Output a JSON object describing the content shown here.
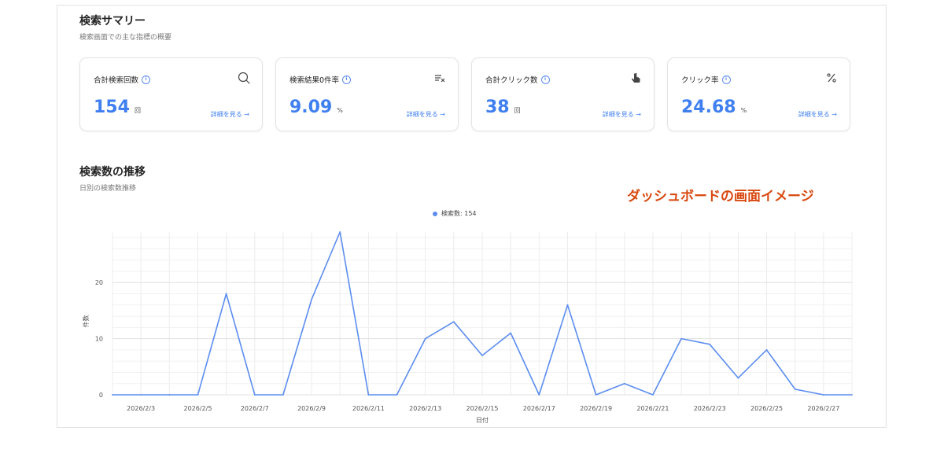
{
  "summary": {
    "title": "検索サマリー",
    "subtitle": "検索画面での主な指標の概要"
  },
  "cards": [
    {
      "label": "合計検索回数",
      "value": "154",
      "unit": "回",
      "link": "詳細を見る →",
      "icon": "search-icon"
    },
    {
      "label": "検索結果0件率",
      "value": "9.09",
      "unit": "%",
      "link": "詳細を見る →",
      "icon": "filter-clear-icon"
    },
    {
      "label": "合計クリック数",
      "value": "38",
      "unit": "回",
      "link": "詳細を見る →",
      "icon": "pointer-hand-icon"
    },
    {
      "label": "クリック率",
      "value": "24.68",
      "unit": "%",
      "link": "詳細を見る →",
      "icon": "percent-icon"
    }
  ],
  "trend": {
    "title": "検索数の推移",
    "subtitle": "日別の検索数推移"
  },
  "watermark": "ダッシュボードの画面イメージ",
  "colors": {
    "accent": "#3f7ff0",
    "line": "#5b8def",
    "watermark": "#d9480f"
  },
  "chart_data": {
    "type": "line",
    "legend": "検索数: 154",
    "legend_position": "top-center",
    "xlabel": "日付",
    "ylabel": "件数",
    "grid": true,
    "ylim": [
      0,
      29
    ],
    "yticks": [
      0,
      10,
      20
    ],
    "x": [
      "2026/2/2",
      "2026/2/3",
      "2026/2/4",
      "2026/2/5",
      "2026/2/6",
      "2026/2/7",
      "2026/2/8",
      "2026/2/9",
      "2026/2/10",
      "2026/2/11",
      "2026/2/12",
      "2026/2/13",
      "2026/2/14",
      "2026/2/15",
      "2026/2/16",
      "2026/2/17",
      "2026/2/18",
      "2026/2/19",
      "2026/2/20",
      "2026/2/21",
      "2026/2/22",
      "2026/2/23",
      "2026/2/24",
      "2026/2/25",
      "2026/2/26",
      "2026/2/27",
      "2026/2/28"
    ],
    "xtick_labels": [
      "2026/2/3",
      "2026/2/5",
      "2026/2/7",
      "2026/2/9",
      "2026/2/11",
      "2026/2/13",
      "2026/2/15",
      "2026/2/17",
      "2026/2/19",
      "2026/2/21",
      "2026/2/23",
      "2026/2/25",
      "2026/2/27"
    ],
    "series": [
      {
        "name": "検索数",
        "values": [
          0,
          0,
          0,
          0,
          18,
          0,
          0,
          17,
          29,
          0,
          0,
          10,
          13,
          7,
          11,
          0,
          16,
          0,
          2,
          0,
          10,
          9,
          3,
          8,
          1,
          0,
          0
        ]
      }
    ]
  }
}
